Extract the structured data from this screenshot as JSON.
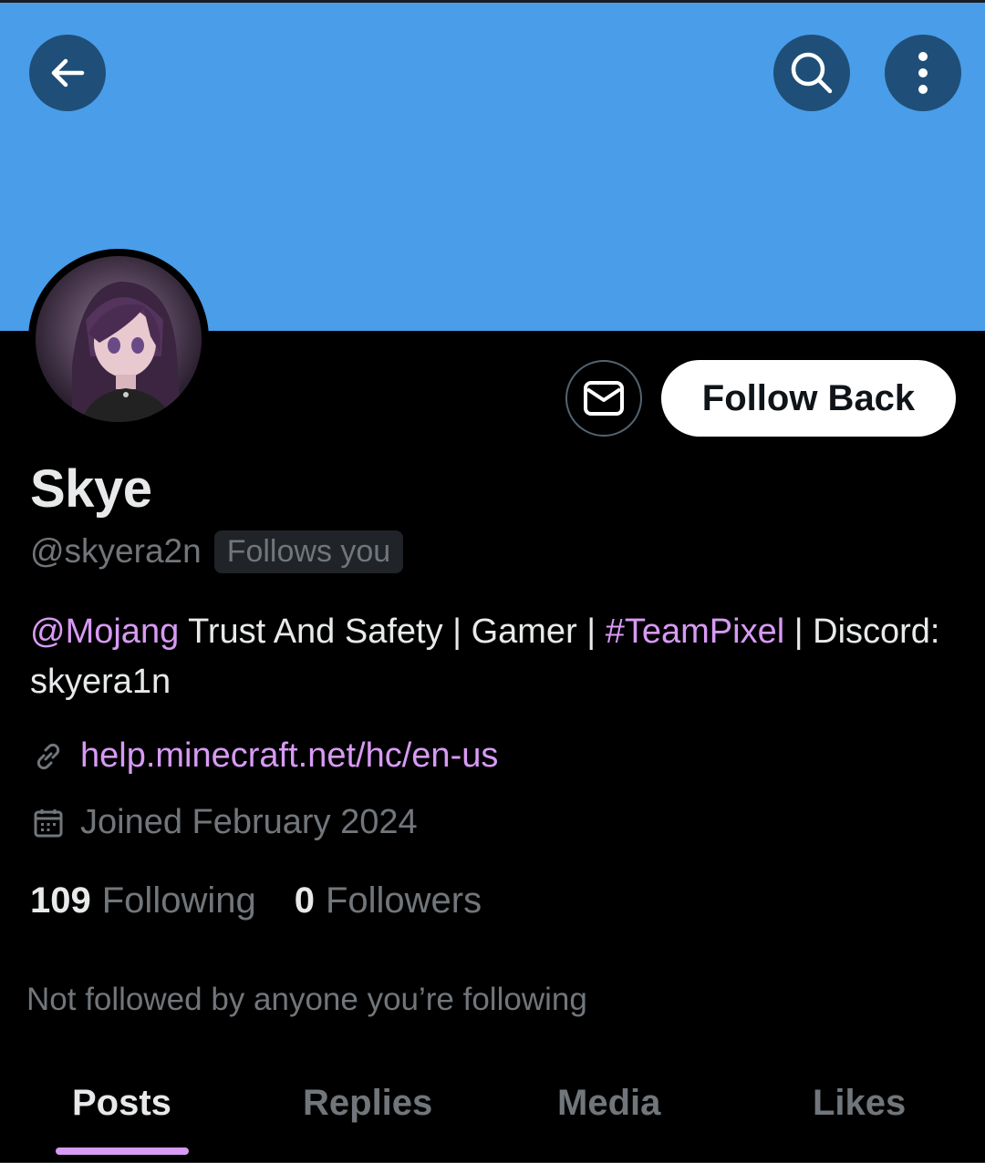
{
  "header": {
    "back_icon": "arrow-left-icon",
    "search_icon": "search-icon",
    "more_icon": "more-vertical-icon",
    "banner_color": "#4a9de8"
  },
  "profile": {
    "name": "Skye",
    "handle": "@skyera2n",
    "follows_you_badge": "Follows you",
    "message_icon": "mail-icon",
    "follow_button_label": "Follow Back",
    "bio": {
      "mention": "@Mojang",
      "text1": " Trust And Safety | Gamer | ",
      "hashtag": "#TeamPixel",
      "text2": " | Discord: skyera1n"
    },
    "website": "help.minecraft.net/hc/en-us",
    "joined": "Joined February 2024",
    "following_count": "109",
    "following_label": "Following",
    "followers_count": "0",
    "followers_label": "Followers",
    "not_followed_text": "Not followed by anyone you’re following"
  },
  "tabs": [
    {
      "label": "Posts",
      "active": true
    },
    {
      "label": "Replies",
      "active": false
    },
    {
      "label": "Media",
      "active": false
    },
    {
      "label": "Likes",
      "active": false
    }
  ],
  "colors": {
    "accent": "#d89af5",
    "secondary_text": "#71767b",
    "primary_text": "#e7e9ea",
    "button_bg": "#1f4f78"
  }
}
